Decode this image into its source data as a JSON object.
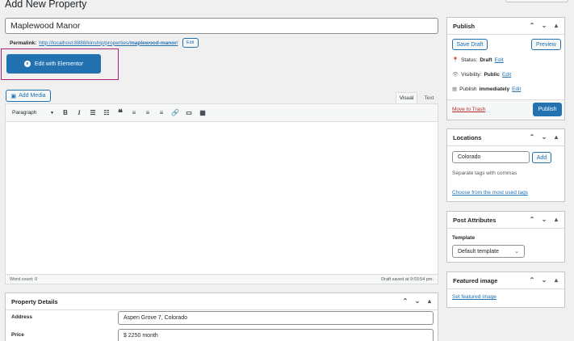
{
  "page_heading": "Add New Property",
  "title_input": "Maplewood Manor",
  "permalink": {
    "label": "Permalink:",
    "url_base": "http://localhost:8888/kinship/properties/",
    "slug": "maplewood-manor",
    "trail": "/",
    "edit_label": "Edit"
  },
  "elementor_button": "Edit with Elementor",
  "add_media": "Add Media",
  "editor_tabs": {
    "visual": "Visual",
    "text": "Text"
  },
  "format_select": "Paragraph",
  "toolbar_icons": [
    "bold-icon",
    "italic-icon",
    "bullet-list-icon",
    "numbered-list-icon",
    "blockquote-icon",
    "align-left-icon",
    "align-center-icon",
    "align-right-icon",
    "link-icon",
    "read-more-icon",
    "toolbar-toggle-icon"
  ],
  "word_count": "Word count: 0",
  "draft_saved": "Draft saved at 9:03:54 pm.",
  "property_details": {
    "title": "Property Details",
    "fields": [
      {
        "label": "Address",
        "value": "Aspen Grove 7, Colorado"
      },
      {
        "label": "Price",
        "value": "$ 2250 month"
      }
    ]
  },
  "publish": {
    "title": "Publish",
    "save_draft": "Save Draft",
    "preview": "Preview",
    "status_label": "Status:",
    "status_value": "Draft",
    "visibility_label": "Visibility:",
    "visibility_value": "Public",
    "publish_label": "Publish",
    "publish_value": "immediately",
    "edit": "Edit",
    "trash": "Move to Trash",
    "publish_button": "Publish"
  },
  "locations": {
    "title": "Locations",
    "input_value": "Colorado",
    "add": "Add",
    "hint": "Separate tags with commas",
    "choose": "Choose from the most used tags"
  },
  "post_attributes": {
    "title": "Post Attributes",
    "template_label": "Template",
    "template_value": "Default template"
  },
  "featured_image": {
    "title": "Featured image",
    "set_link": "Set featured image"
  }
}
